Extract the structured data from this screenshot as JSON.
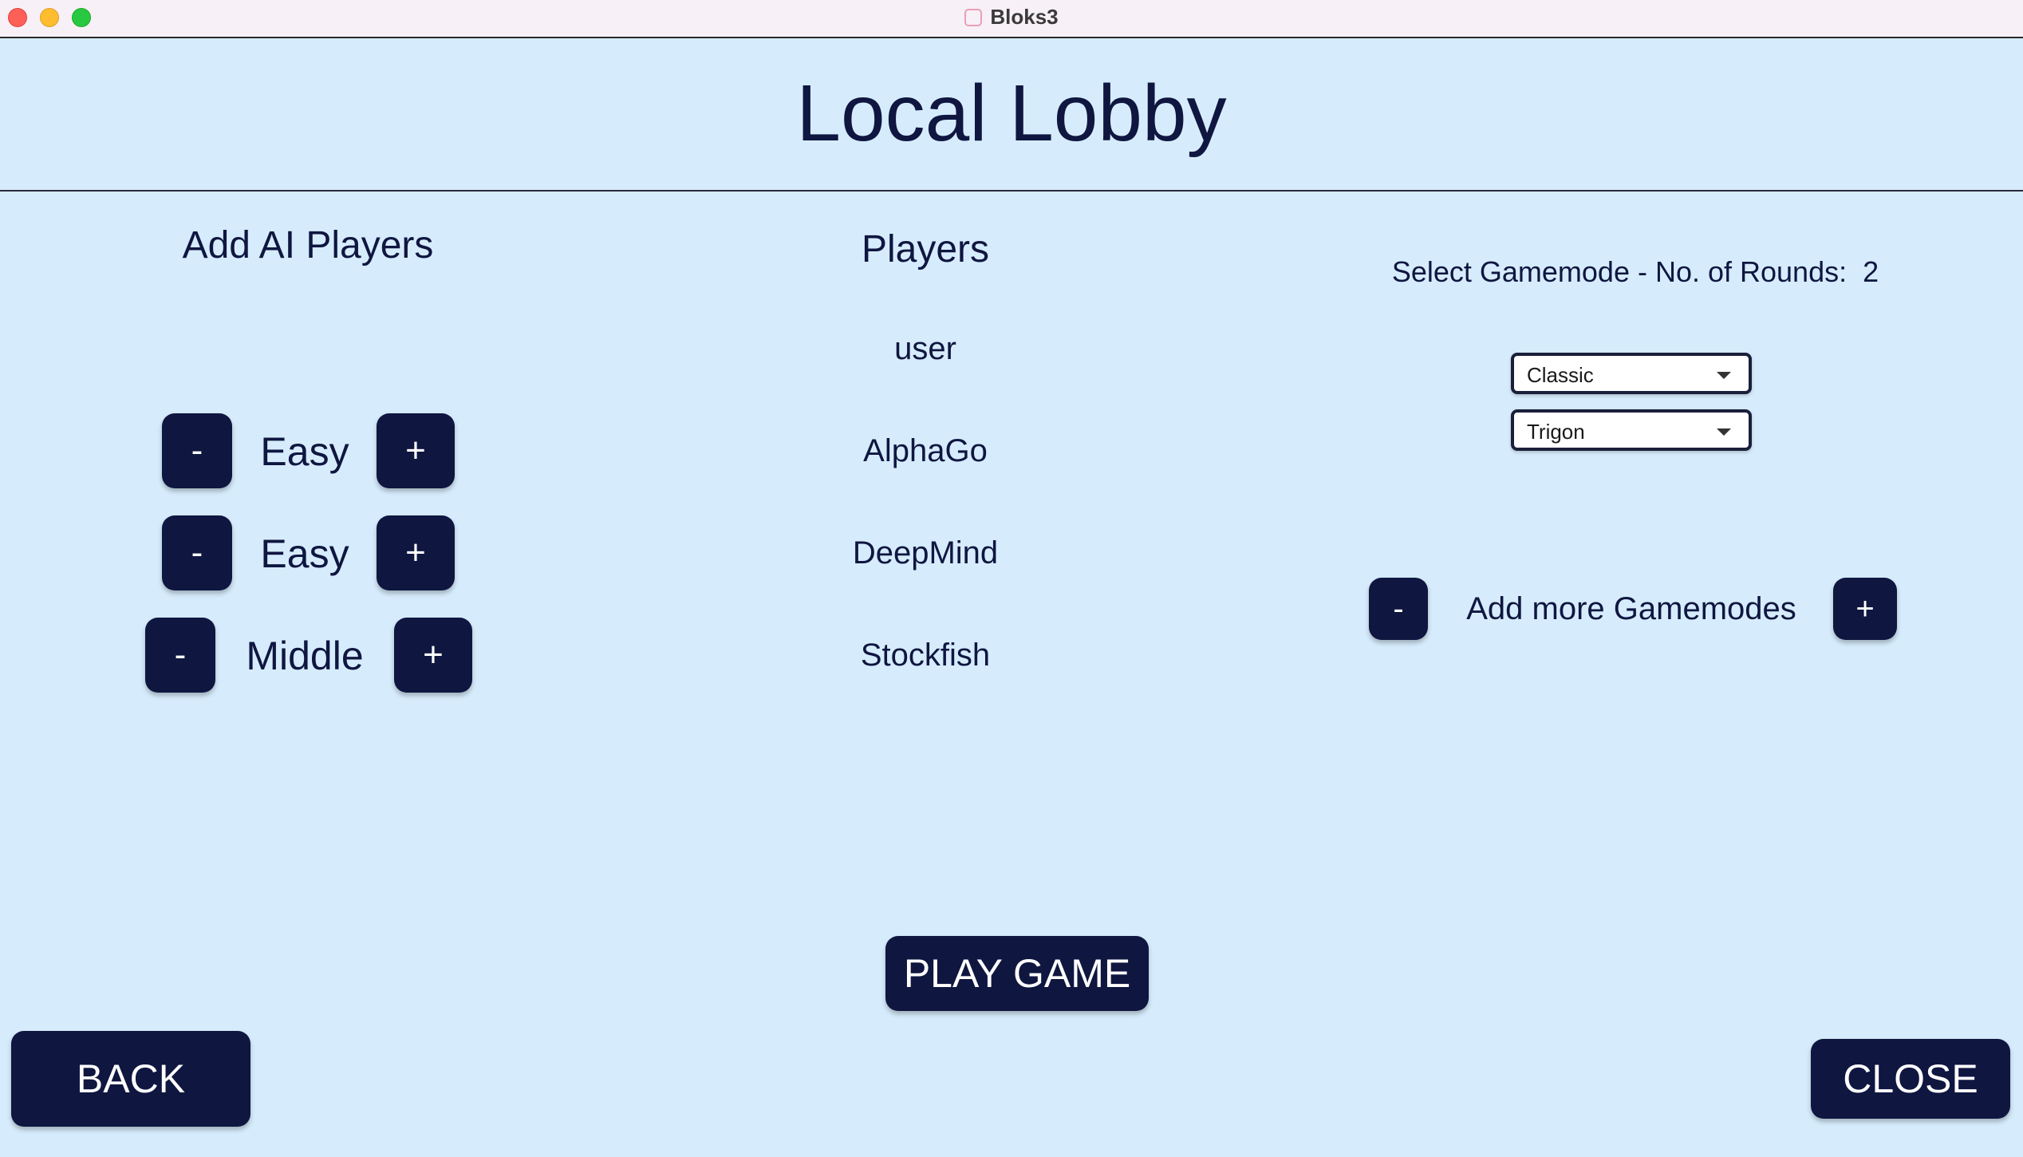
{
  "window": {
    "title": "Bloks3"
  },
  "page": {
    "title": "Local Lobby"
  },
  "ai_players": {
    "title": "Add AI Players",
    "minus_label": "-",
    "plus_label": "+",
    "rows": [
      {
        "difficulty": "Easy"
      },
      {
        "difficulty": "Easy"
      },
      {
        "difficulty": "Middle"
      }
    ]
  },
  "players": {
    "title": "Players",
    "list": [
      "user",
      "AlphaGo",
      "DeepMind",
      "Stockfish"
    ]
  },
  "gamemode": {
    "title": "Select Gamemode - No. of Rounds:",
    "rounds": "2",
    "selects": [
      "Classic",
      "Trigon"
    ],
    "add_more_label": "Add more Gamemodes",
    "minus_label": "-",
    "plus_label": "+"
  },
  "actions": {
    "play_game": "PLAY GAME",
    "back": "BACK",
    "close": "CLOSE"
  },
  "colors": {
    "background": "#d6ecfc",
    "button": "#0f1640",
    "button_text": "#ffffff",
    "titlebar": "#f7f0f7"
  }
}
